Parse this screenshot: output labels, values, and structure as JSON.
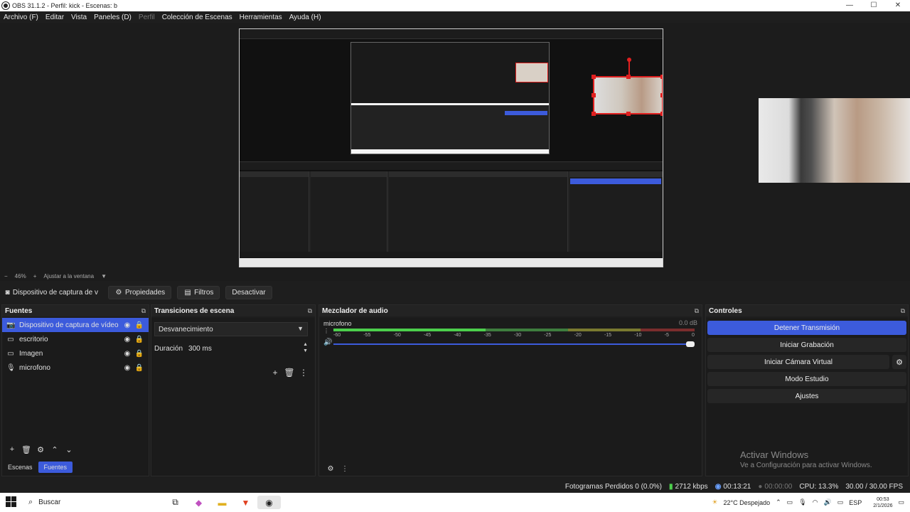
{
  "window": {
    "title": "OBS 31.1.2 - Perfil: kick - Escenas: b",
    "minimize": "—",
    "maximize": "☐",
    "close": "✕"
  },
  "menu": {
    "items": [
      "Archivo (F)",
      "Editar",
      "Vista",
      "Paneles (D)",
      "Perfil",
      "Colección de Escenas",
      "Herramientas",
      "Ayuda (H)"
    ],
    "disabled_item": "Perfil"
  },
  "zoom": {
    "minus": "−",
    "level": "46%",
    "plus": "+",
    "fit_label": "Ajustar a la ventana",
    "dropdown": "▼"
  },
  "source_toolbar": {
    "selected_source": "Dispositivo de captura de v",
    "properties": "Propiedades",
    "filters": "Filtros",
    "deactivate": "Desactivar"
  },
  "sources": {
    "title": "Fuentes",
    "items": [
      {
        "name": "Dispositivo de captura de vídeo",
        "icon": "camera-icon",
        "glyph": "📷"
      },
      {
        "name": "escritorio",
        "icon": "monitor-icon",
        "glyph": "▭"
      },
      {
        "name": "Imagen",
        "icon": "image-icon",
        "glyph": "▭"
      },
      {
        "name": "microfono",
        "icon": "microphone-icon",
        "glyph": "🎙"
      }
    ],
    "tabs": [
      "Escenas",
      "Fuentes"
    ],
    "active_tab": "Fuentes"
  },
  "transitions": {
    "title": "Transiciones de escena",
    "selected": "Desvanecimiento",
    "duration_label": "Duración",
    "duration_value": "300 ms"
  },
  "mixer": {
    "title": "Mezclador de audio",
    "channel": "microfono",
    "db": "0.0 dB",
    "level_fraction": 0.42,
    "volume_fraction": 1.0,
    "ticks": [
      "-60",
      "-55",
      "-50",
      "-45",
      "-40",
      "-35",
      "-30",
      "-25",
      "-20",
      "-15",
      "-10",
      "-5",
      "0"
    ]
  },
  "controls": {
    "title": "Controles",
    "stop_stream": "Detener Transmisión",
    "start_recording": "Iniciar Grabación",
    "virtual_camera": "Iniciar Cámara Virtual",
    "studio_mode": "Modo Estudio",
    "settings": "Ajustes"
  },
  "watermark": {
    "line1": "Activar Windows",
    "line2": "Ve a Configuración para activar Windows."
  },
  "status": {
    "dropped_frames": "Fotogramas Perdidos 0 (0.0%)",
    "bitrate": "2712 kbps",
    "stream_time": "00:13:21",
    "record_time": "00:00:00",
    "cpu": "CPU: 13.3%",
    "fps": "30.00 / 30.00 FPS"
  },
  "taskbar": {
    "search_placeholder": "Buscar",
    "weather": "22°C  Despejado",
    "language": "ESP",
    "time": "00:53",
    "date": "2/1/2026"
  },
  "colors": {
    "accent": "#3c5bdc",
    "background": "#1e1e1e",
    "selection_red": "#e02020",
    "meter_green": "#4ccf4c"
  }
}
